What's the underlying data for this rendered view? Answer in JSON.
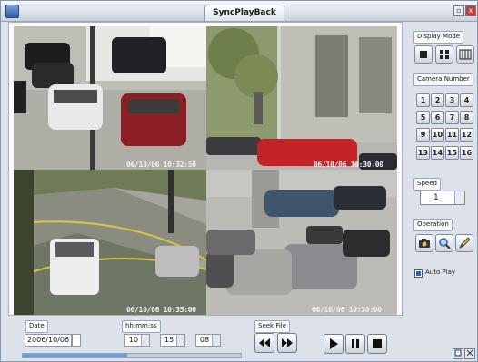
{
  "window": {
    "title": "SyncPlayBack",
    "minimize_glyph": "▫",
    "close_glyph": "x"
  },
  "cameras": [
    {
      "timestamp": "06/10/06 10:32:50"
    },
    {
      "timestamp": "06/10/06 10:30:00"
    },
    {
      "timestamp": "06/10/06 10:35:00"
    },
    {
      "timestamp": "06/10/06 10:38:00"
    }
  ],
  "sidebar": {
    "display_mode_label": "Display Mode",
    "camera_number_label": "Camera Number",
    "camera_numbers": [
      "1",
      "2",
      "3",
      "4",
      "5",
      "6",
      "7",
      "8",
      "9",
      "10",
      "11",
      "12",
      "13",
      "14",
      "15",
      "16"
    ],
    "speed_label": "Speed",
    "speed_value": "1",
    "operation_label": "Operation",
    "auto_play_label": "Auto Play",
    "auto_play_checked": true
  },
  "bottom": {
    "date_label": "Date",
    "date_value": "2006/10/06",
    "time_label": "hh:mm:ss",
    "hour": "10",
    "minute": "15",
    "second": "08",
    "seek_label": "Seek File"
  },
  "colors": {
    "accent": "#2f5ea8",
    "panel": "#dde2ea"
  }
}
